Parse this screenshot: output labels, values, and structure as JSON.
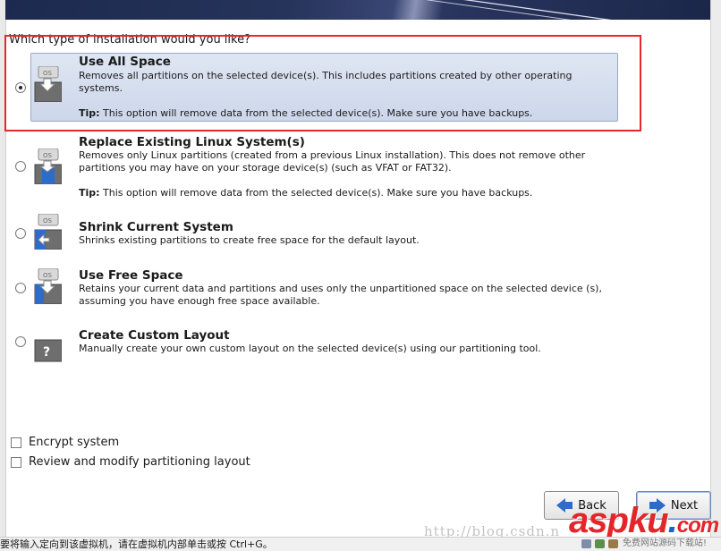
{
  "question": "Which type of installation would you like?",
  "options": [
    {
      "title": "Use All Space",
      "description": "Removes all partitions on the selected device(s).  This includes partitions created by other operating systems.",
      "tip_label": "Tip:",
      "tip_text": " This option will remove data from the selected device(s).  Make sure you have backups.",
      "selected": true,
      "icon": "os-disk-down-icon"
    },
    {
      "title": "Replace Existing Linux System(s)",
      "description": "Removes only Linux partitions (created from a previous Linux installation).  This does not remove other partitions you may have on your storage device(s) (such as VFAT or FAT32).",
      "tip_label": "Tip:",
      "tip_text": " This option will remove data from the selected device(s).  Make sure you have backups.",
      "selected": false,
      "icon": "os-disk-replace-icon"
    },
    {
      "title": "Shrink Current System",
      "description": "Shrinks existing partitions to create free space for the default layout.",
      "selected": false,
      "icon": "os-disk-shrink-icon"
    },
    {
      "title": "Use Free Space",
      "description": "Retains your current data and partitions and uses only the unpartitioned space on the selected device (s), assuming you have enough free space available.",
      "selected": false,
      "icon": "os-disk-free-icon"
    },
    {
      "title": "Create Custom Layout",
      "description": "Manually create your own custom layout on the selected device(s) using our partitioning tool.",
      "selected": false,
      "icon": "custom-layout-question-icon"
    }
  ],
  "checkboxes": {
    "encrypt": "Encrypt system",
    "review": "Review and modify partitioning layout"
  },
  "buttons": {
    "back": "Back",
    "next": "Next"
  },
  "statusbar": {
    "message": "要将输入定向到该虚拟机，请在虚拟机内部单击或按 Ctrl+G。"
  },
  "watermark": {
    "url": "http://blog.csdn.n",
    "logo_main": "aspku",
    "logo_dot": ".",
    "logo_end": "com",
    "sub": "免费网站源码下载站!"
  },
  "colors": {
    "highlight": "#e8262c",
    "selection": "#cdd7ea",
    "arrow": "#2f6bc8"
  }
}
